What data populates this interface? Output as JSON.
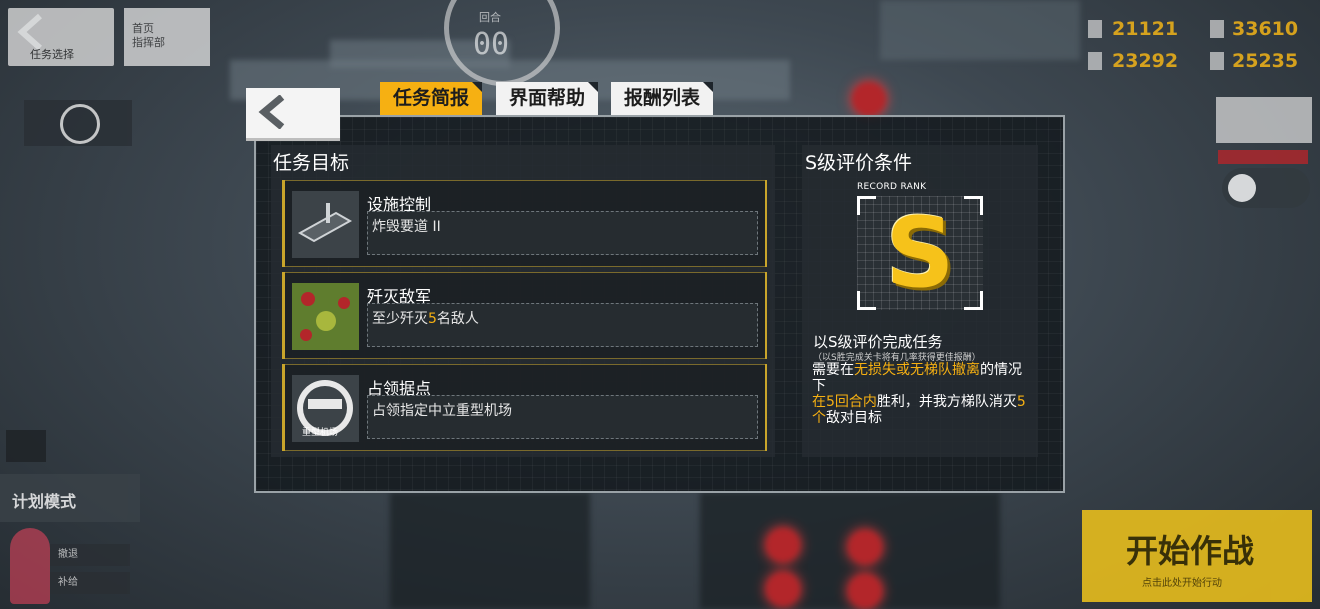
{
  "hud": {
    "back_label": "任务选择",
    "home_label_1": "首页",
    "home_label_2": "指挥部",
    "turn_label": "回合",
    "turn_number": "00",
    "resources": [
      "21121",
      "33610",
      "23292",
      "25235"
    ],
    "plan_mode_label": "计划模式",
    "pink_row_1": "撤退",
    "pink_row_2": "补给",
    "start_button": {
      "label": "开始作战",
      "sub": "点击此处开始行动"
    }
  },
  "dialog": {
    "tabs": [
      {
        "label": "任务简报",
        "active": true
      },
      {
        "label": "界面帮助",
        "active": false
      },
      {
        "label": "报酬列表",
        "active": false
      }
    ],
    "objectives": {
      "title": "任务目标",
      "items": [
        {
          "name": "设施控制",
          "desc": "炸毁要道 II",
          "icon": "facility-icon"
        },
        {
          "name": "歼灭敌军",
          "desc_pre": "至少歼灭",
          "desc_num": "5",
          "desc_post": "名敌人",
          "icon": "enemy-map-icon"
        },
        {
          "name": "占领据点",
          "desc": "占领指定中立重型机场",
          "icon": "heavy-airport-icon",
          "icon_text": "重型机场"
        }
      ]
    },
    "rank": {
      "title": "S级评价条件",
      "record_label": "RECORD RANK",
      "letter": "S",
      "cond_title": "以S级评价完成任务",
      "cond_note": "（以S胜完成关卡将有几率获得更佳报酬）",
      "line1_pre": "需要在",
      "line1_hl": "无损失或无梯队撤离",
      "line1_post": "的情况下",
      "line2_hl1": "在5回合内",
      "line2_mid": "胜利，并我方梯队消灭",
      "line2_hl2": "5个",
      "line2_post": "敌对目标"
    }
  },
  "colors": {
    "accent": "#f6b012",
    "dialog_bg": "#141a1f",
    "start_button": "#f2c51b"
  }
}
